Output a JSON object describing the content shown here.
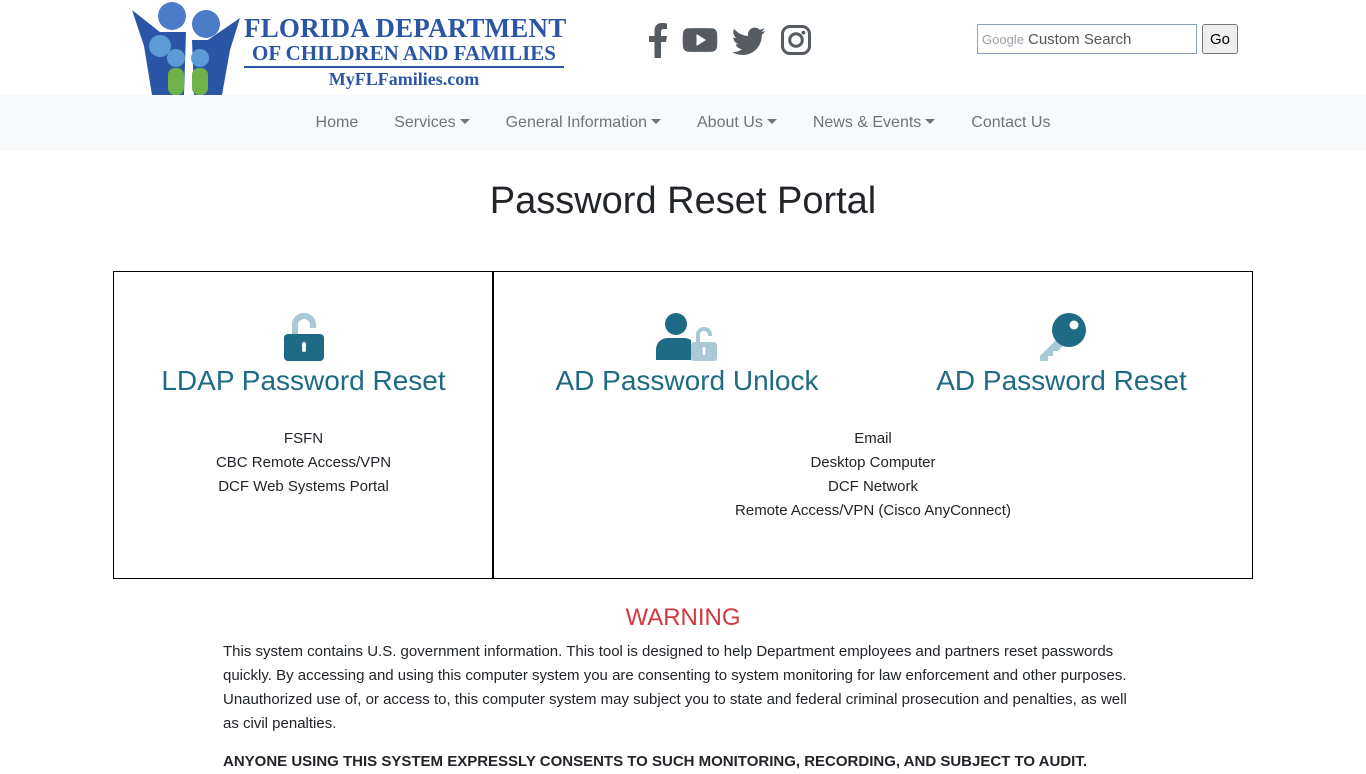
{
  "header": {
    "logo": {
      "line1": "FLORIDA DEPARTMENT",
      "line2": "OF CHILDREN AND FAMILIES",
      "line3": "MyFLFamilies.com"
    },
    "social": [
      {
        "icon": "facebook-icon"
      },
      {
        "icon": "youtube-icon"
      },
      {
        "icon": "twitter-icon"
      },
      {
        "icon": "instagram-icon"
      }
    ],
    "search": {
      "brand": "Google",
      "placeholder": "Custom Search",
      "button_label": "Go"
    }
  },
  "nav": {
    "items": [
      {
        "label": "Home"
      },
      {
        "label": "Services"
      },
      {
        "label": "General Information"
      },
      {
        "label": "About Us"
      },
      {
        "label": "News & Events"
      },
      {
        "label": "Contact Us"
      }
    ]
  },
  "main": {
    "title": "Password Reset Portal",
    "ldap": {
      "label": "LDAP Password Reset",
      "systems": [
        "FSFN",
        "CBC Remote Access/VPN",
        "DCF Web Systems Portal"
      ]
    },
    "ad_unlock": {
      "label": "AD Password Unlock"
    },
    "ad_reset": {
      "label": "AD Password Reset"
    },
    "ad_systems": [
      "Email",
      "Desktop Computer",
      "DCF Network",
      "Remote Access/VPN (Cisco AnyConnect)"
    ]
  },
  "warning": {
    "title": "WARNING",
    "text": "This system contains U.S. government information. This tool is designed to help Department employees and partners reset passwords quickly. By accessing and using this computer system you are consenting to system monitoring for law enforcement and other purposes. Unauthorized use of, or access to, this computer system may subject you to state and federal criminal prosecution and penalties, as well as civil penalties.",
    "consent": "ANYONE USING THIS SYSTEM EXPRESSLY CONSENTS TO SUCH MONITORING, RECORDING, AND SUBJECT TO AUDIT."
  },
  "colors": {
    "brand_blue": "#2a56a5",
    "portal_teal": "#1f6b85",
    "icon_light": "#a9c9d6",
    "warning_red": "#d0393e"
  }
}
